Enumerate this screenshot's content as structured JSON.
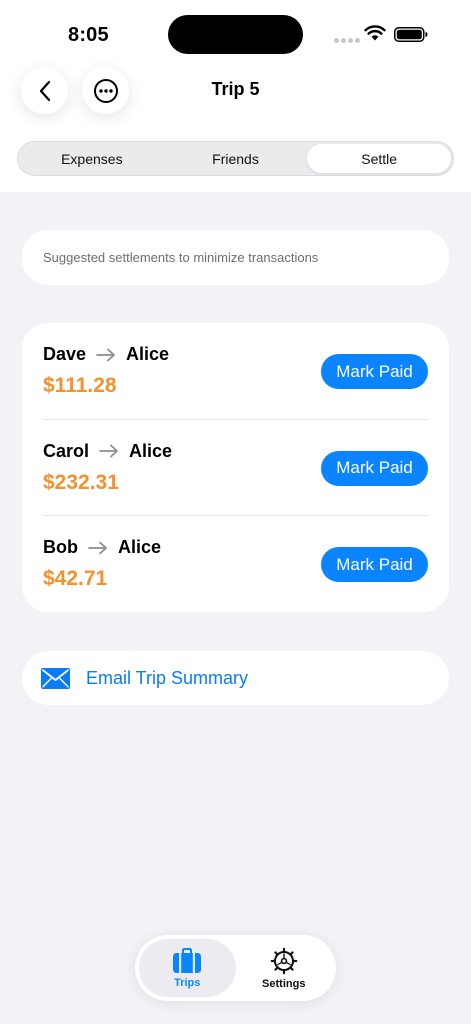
{
  "status_bar": {
    "time": "8:05"
  },
  "nav": {
    "title": "Trip 5"
  },
  "segments": [
    {
      "label": "Expenses",
      "active": false
    },
    {
      "label": "Friends",
      "active": false
    },
    {
      "label": "Settle",
      "active": true
    }
  ],
  "hint": "Suggested settlements to minimize transactions",
  "settlements": [
    {
      "from": "Dave",
      "to": "Alice",
      "amount": "$111.28",
      "action": "Mark Paid"
    },
    {
      "from": "Carol",
      "to": "Alice",
      "amount": "$232.31",
      "action": "Mark Paid"
    },
    {
      "from": "Bob",
      "to": "Alice",
      "amount": "$42.71",
      "action": "Mark Paid"
    }
  ],
  "email": {
    "label": "Email Trip Summary",
    "icon": "envelope-icon"
  },
  "tab_bar": {
    "items": [
      {
        "label": "Trips",
        "icon": "suitcase-icon",
        "active": true
      },
      {
        "label": "Settings",
        "icon": "gear-icon",
        "active": false
      }
    ]
  },
  "colors": {
    "accent": "#0a84ff",
    "amount": "#f2912d",
    "background": "#f2f2f7"
  }
}
